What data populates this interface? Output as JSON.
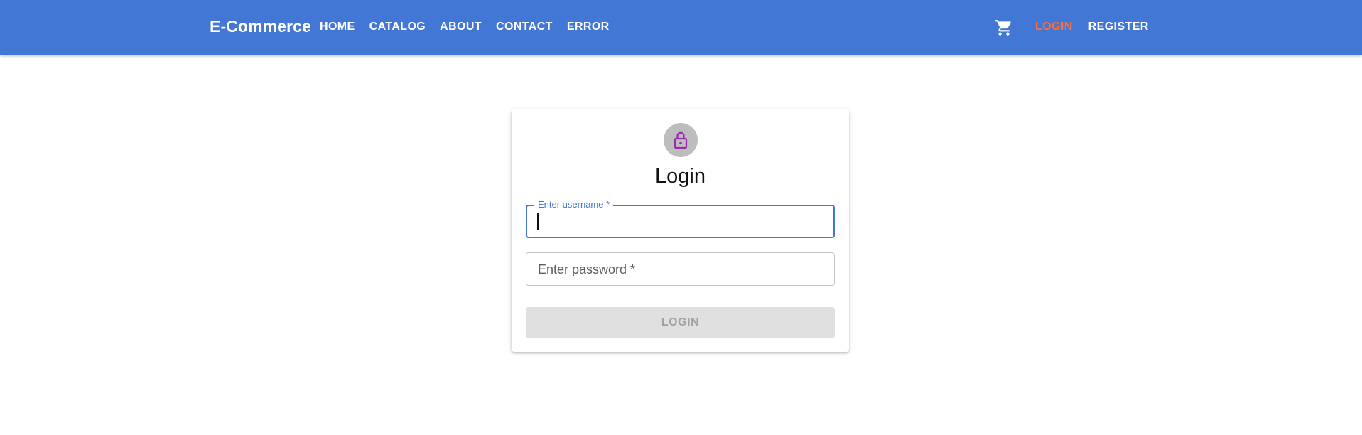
{
  "header": {
    "brand": "E-Commerce",
    "nav": [
      "HOME",
      "CATALOG",
      "ABOUT",
      "CONTACT",
      "ERROR"
    ],
    "cart_icon": "shopping-cart-icon",
    "auth": {
      "login": "LOGIN",
      "register": "REGISTER",
      "active": "login"
    },
    "colors": {
      "bar": "#4377d6",
      "active_link": "#ff6d3a"
    }
  },
  "login_card": {
    "icon": "lock-open-icon",
    "icon_color": "#9c27b0",
    "title": "Login",
    "username": {
      "label": "Enter username *",
      "value": "",
      "focused": true
    },
    "password": {
      "placeholder": "Enter password *",
      "value": ""
    },
    "submit_label": "LOGIN",
    "submit_disabled": true
  }
}
